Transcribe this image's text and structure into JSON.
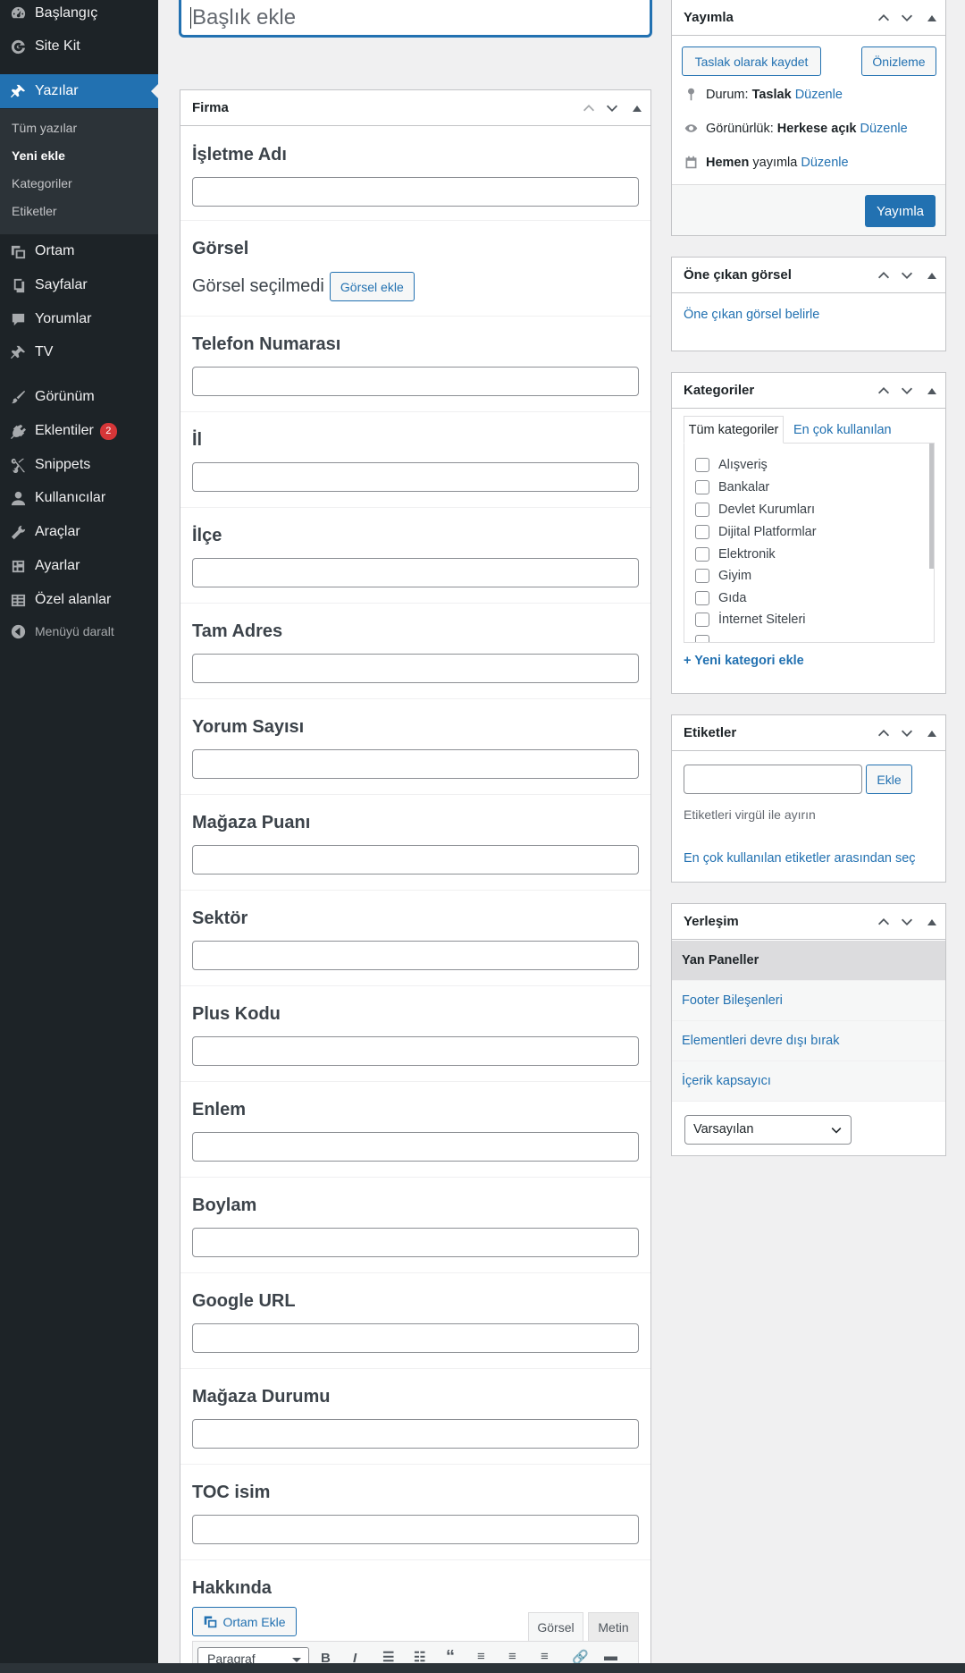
{
  "sidebar": {
    "items": [
      {
        "label": "Başlangıç",
        "icon": "dashboard-icon"
      },
      {
        "label": "Site Kit",
        "icon": "google-icon"
      },
      {
        "label": "Yazılar",
        "icon": "pin-icon"
      },
      {
        "label": "Ortam",
        "icon": "media-icon"
      },
      {
        "label": "Sayfalar",
        "icon": "pages-icon"
      },
      {
        "label": "Yorumlar",
        "icon": "comment-icon"
      },
      {
        "label": "TV",
        "icon": "pin-icon"
      },
      {
        "label": "Görünüm",
        "icon": "brush-icon"
      },
      {
        "label": "Eklentiler",
        "icon": "plugin-icon",
        "badge": "2"
      },
      {
        "label": "Snippets",
        "icon": "scissors-icon"
      },
      {
        "label": "Kullanıcılar",
        "icon": "user-icon"
      },
      {
        "label": "Araçlar",
        "icon": "wrench-icon"
      },
      {
        "label": "Ayarlar",
        "icon": "settings-icon"
      },
      {
        "label": "Özel alanlar",
        "icon": "table-icon"
      }
    ],
    "submenu": [
      "Tüm yazılar",
      "Yeni ekle",
      "Kategoriler",
      "Etiketler"
    ],
    "collapse_label": "Menüyü daralt"
  },
  "title_placeholder": "Başlık ekle",
  "firma": {
    "title": "Firma",
    "fields": [
      "İşletme Adı",
      "Görsel",
      "Telefon Numarası",
      "İl",
      "İlçe",
      "Tam Adres",
      "Yorum Sayısı",
      "Mağaza Puanı",
      "Sektör",
      "Plus Kodu",
      "Enlem",
      "Boylam",
      "Google URL",
      "Mağaza Durumu",
      "TOC isim",
      "Hakkında"
    ],
    "image_none": "Görsel seçilmedi",
    "image_button": "Görsel ekle",
    "media_button": "Ortam Ekle",
    "tab_visual": "Görsel",
    "tab_text": "Metin",
    "format_select": "Paragraf"
  },
  "publish": {
    "title": "Yayımla",
    "save_draft": "Taslak olarak kaydet",
    "preview": "Önizleme",
    "status_label": "Durum:",
    "status_value": "Taslak",
    "visibility_label": "Görünürlük:",
    "visibility_value": "Herkese açık",
    "publish_when": "Hemen",
    "publish_suffix": "yayımla",
    "edit_link": "Düzenle",
    "publish_button": "Yayımla"
  },
  "featured": {
    "title": "Öne çıkan görsel",
    "link": "Öne çıkan görsel belirle"
  },
  "categories": {
    "title": "Kategoriler",
    "tab_all": "Tüm kategoriler",
    "tab_popular": "En çok kullanılan",
    "items": [
      "Alışveriş",
      "Bankalar",
      "Devlet Kurumları",
      "Dijital Platformlar",
      "Elektronik",
      "Giyim",
      "Gıda",
      "İnternet Siteleri"
    ],
    "add_link": "+ Yeni kategori ekle"
  },
  "tags": {
    "title": "Etiketler",
    "add_button": "Ekle",
    "hint": "Etiketleri virgül ile ayırın",
    "popular_link": "En çok kullanılan etiketler arasından seç"
  },
  "layout": {
    "title": "Yerleşim",
    "items": [
      "Yan Paneller",
      "Footer Bileşenleri",
      "Elementleri devre dışı bırak",
      "İçerik kapsayıcı"
    ],
    "select_value": "Varsayılan"
  }
}
